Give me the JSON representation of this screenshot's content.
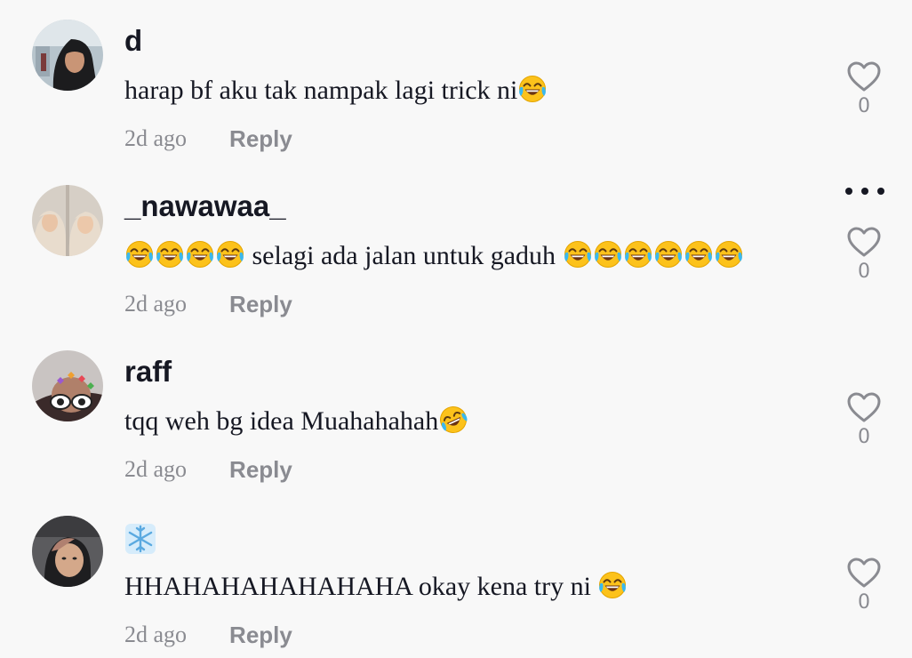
{
  "comments": [
    {
      "username": "d",
      "text": "harap bf aku tak nampak lagi trick ni",
      "text_emoji_suffix": [
        "face-with-tears-of-joy-icon"
      ],
      "timestamp": "2d ago",
      "reply_label": "Reply",
      "like_count": "0"
    },
    {
      "username": "_nawawaa_",
      "text_emoji_prefix_count": 4,
      "text": "selagi ada jalan untuk gaduh",
      "text_emoji_suffix_count": 6,
      "timestamp": "2d ago",
      "reply_label": "Reply",
      "like_count": "0"
    },
    {
      "username": "raff",
      "text": "tqq weh bg idea Muahahahah",
      "text_emoji_suffix": [
        "rolling-on-floor-laughing-icon"
      ],
      "timestamp": "2d ago",
      "reply_label": "Reply",
      "like_count": "0"
    },
    {
      "username_icon": "snowflake-icon",
      "text": "HHAHAHAHAHAHAHA okay kena try ni",
      "text_emoji_suffix": [
        "face-with-tears-of-joy-icon"
      ],
      "timestamp": "2d ago",
      "reply_label": "Reply",
      "like_count": "0"
    }
  ],
  "icons": {
    "like": "heart-outline-icon",
    "more": "more-options-icon"
  },
  "colors": {
    "background": "#f8f8f8",
    "text_primary": "#161823",
    "text_secondary": "#8a8b91",
    "emoji_face": "#fcc21b"
  }
}
